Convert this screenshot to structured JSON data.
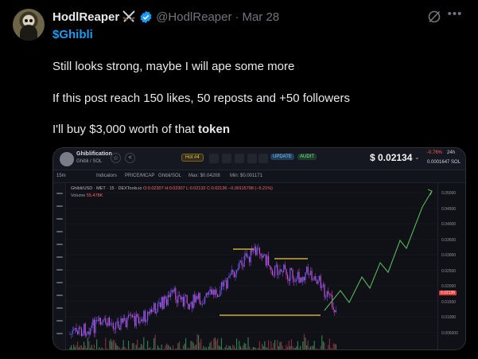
{
  "tweet": {
    "display_name": "HodlReaper",
    "handle": "@HodlReaper",
    "separator": "·",
    "date": "Mar 28",
    "cashtag": "$Ghibli",
    "lines": [
      "Still looks strong, maybe I will ape some more",
      "If this post reach 150 likes, 50 reposts and +50 followers"
    ],
    "line3_prefix": "I'll buy $3,000 worth of that ",
    "line3_bold": "token",
    "verified_color": "#1d9bf0"
  },
  "chart_image": {
    "coin_name": "Ghiblification",
    "coin_pair": "Ghibli / SOL",
    "hot_badge": "Hot #4",
    "update_badge": "UPDATE",
    "audit_badge": "AUDIT",
    "price": "$ 0.02134",
    "change_pct": "-0.76%",
    "change_period": "24h",
    "price_sol": "0.0001647 SOL",
    "toolbar": {
      "timeframe": "15m",
      "indicators": "Indicators",
      "price_mcap": "PRICE/MCAP",
      "pair": "Ghibli/SOL",
      "max": "Max: $0.04208",
      "min": "Min: $0.001171"
    },
    "legend": "Ghibli/USD · MET · 15 · DEXTools.io",
    "legend_ohlc": "O:0.02307 H:0.02307 L:0.02132 C:0.02136 −0.00115798 (−5.21%)",
    "volume_label": "Volume",
    "volume_value": "55.478K",
    "price_tag": "0.02136",
    "y_axis": [
      "0.05000",
      "0.04500",
      "0.04000",
      "0.03500",
      "0.03000",
      "0.02500",
      "0.02000",
      "0.01500",
      "0.01000",
      "0.005000"
    ]
  }
}
